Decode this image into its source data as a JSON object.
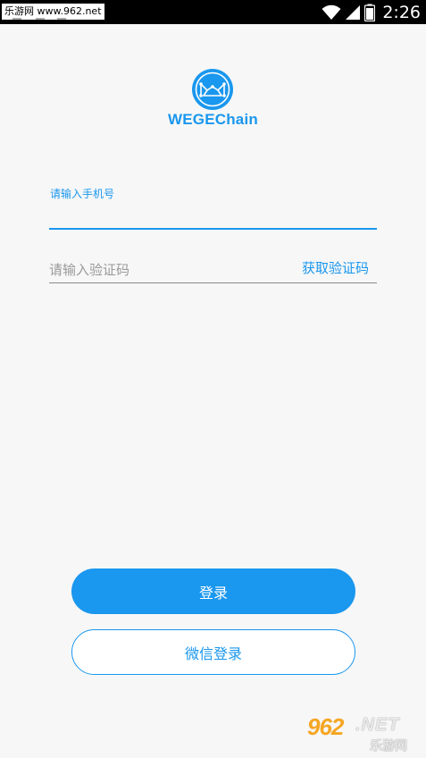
{
  "status_bar": {
    "watermark": "乐游网 www.962.net",
    "time": "2:26",
    "icons": [
      "wifi-icon",
      "signal-icon",
      "battery-icon"
    ]
  },
  "app": {
    "name": "WEGEChain",
    "logo_icon": "wegechain-logo-icon"
  },
  "form": {
    "phone_label": "请输入手机号",
    "phone_value": "",
    "code_placeholder": "请输入验证码",
    "code_value": "",
    "get_code_label": "获取验证码"
  },
  "actions": {
    "login_label": "登录",
    "wechat_login_label": "微信登录"
  },
  "watermark_bottom": {
    "brand": "962",
    "net": ".NET",
    "sub": "乐游网"
  },
  "colors": {
    "accent": "#1a97ee",
    "background": "#f7f7f7",
    "status_bar": "#000000"
  }
}
